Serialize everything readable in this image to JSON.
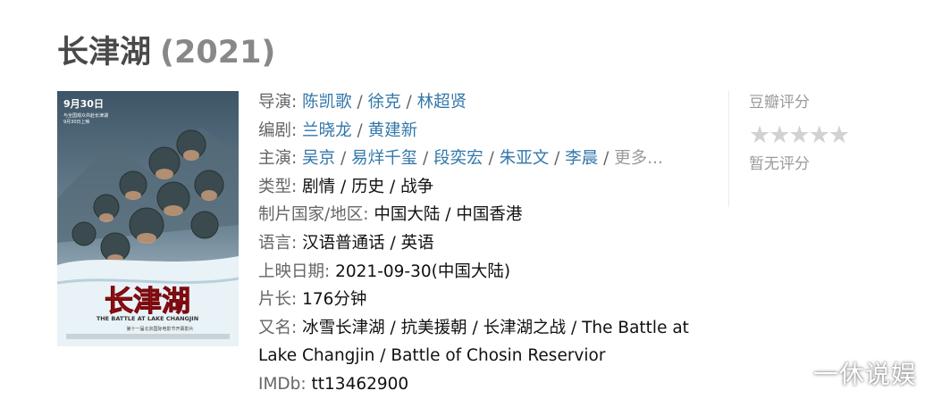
{
  "title": "长津湖",
  "year": "(2021)",
  "poster": {
    "date": "9月30日",
    "line1": "与全国观众共赴长津湖",
    "line2": "9月30日上映",
    "title_cn": "长津湖",
    "title_en": "THE BATTLE AT LAKE CHANGJIN",
    "tagline": "第十一届北京国际电影节开幕影片"
  },
  "info": {
    "director_label": "导演",
    "directors": [
      "陈凯歌",
      "徐克",
      "林超贤"
    ],
    "writer_label": "编剧",
    "writers": [
      "兰晓龙",
      "黄建新"
    ],
    "cast_label": "主演",
    "cast": [
      "吴京",
      "易烊千玺",
      "段奕宏",
      "朱亚文",
      "李晨"
    ],
    "cast_more": "更多...",
    "genre_label": "类型:",
    "genres": [
      "剧情",
      "历史",
      "战争"
    ],
    "region_label": "制片国家/地区:",
    "region": "中国大陆 / 中国香港",
    "language_label": "语言:",
    "language": "汉语普通话 / 英语",
    "release_label": "上映日期:",
    "release": "2021-09-30(中国大陆)",
    "runtime_label": "片长:",
    "runtime": "176分钟",
    "aka_label": "又名:",
    "aka": "冰雪长津湖 / 抗美援朝 / 长津湖之战 / The Battle at Lake Changjin / Battle of Chosin Reservior",
    "imdb_label": "IMDb:",
    "imdb": "tt13462900"
  },
  "rating": {
    "label": "豆瓣评分",
    "stars": 0,
    "stars_display": "★★★★★",
    "none_text": "暂无评分"
  },
  "watermark": "一休说娱",
  "colors": {
    "link": "#3377aa",
    "label": "#666666",
    "title": "#494949",
    "year": "#888888"
  }
}
